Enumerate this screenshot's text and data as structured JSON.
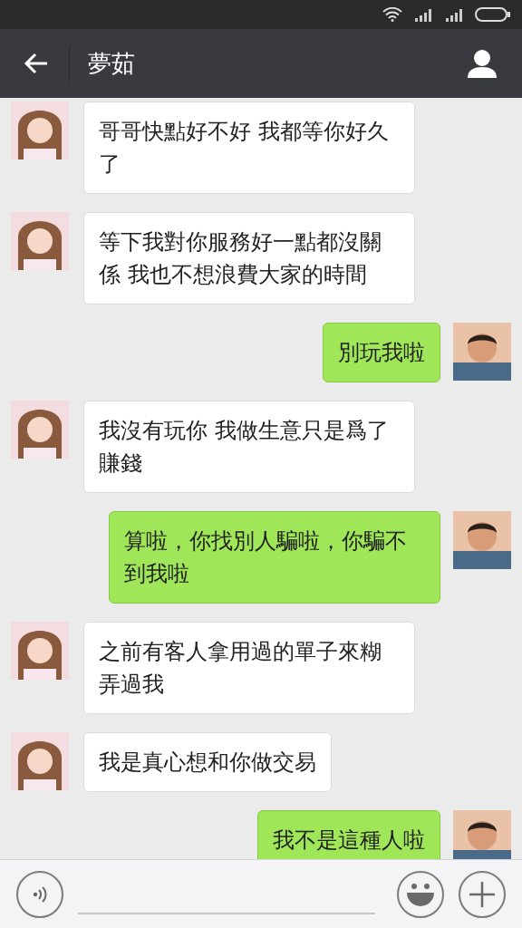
{
  "header": {
    "title": "夢茹"
  },
  "messages": [
    {
      "kind": "received",
      "text": "哥哥快點好不好 我都等你好久了"
    },
    {
      "kind": "received",
      "text": "等下我對你服務好一點都沒關係 我也不想浪費大家的時間"
    },
    {
      "kind": "sent",
      "text": "別玩我啦"
    },
    {
      "kind": "received",
      "text": "我沒有玩你  我做生意只是爲了賺錢"
    },
    {
      "kind": "sent",
      "text": "算啦，你找別人騙啦，你騙不到我啦"
    },
    {
      "kind": "received",
      "text": "之前有客人拿用過的單子來糊弄過我"
    },
    {
      "kind": "received",
      "text": "我是真心想和你做交易"
    },
    {
      "kind": "sent",
      "text": "我不是這種人啦"
    }
  ]
}
